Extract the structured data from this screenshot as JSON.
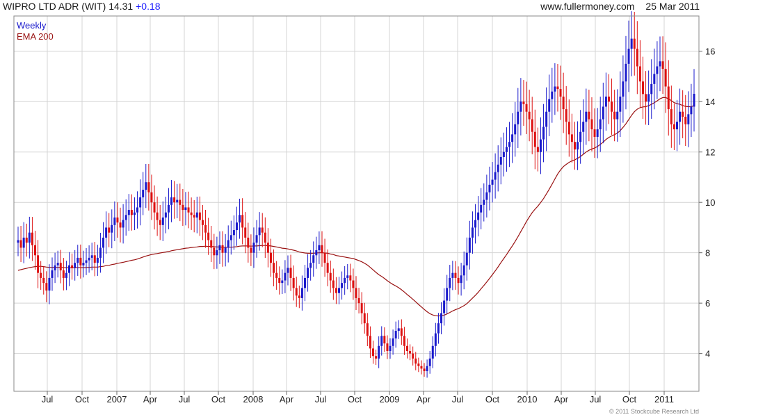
{
  "header": {
    "title": "WIPRO LTD ADR (WIT)",
    "last": "14.31",
    "change": "+0.18",
    "site": "www.fullermoney.com",
    "date": "25 Mar 2011"
  },
  "credit": "© 2011 Stockcube Research Ltd",
  "colors": {
    "up": "#1a1acc",
    "down": "#dd1111",
    "ema": "#991111",
    "grid": "#d4d4d4",
    "frame": "#888888"
  },
  "chart_data": {
    "type": "candlestick",
    "grid": true,
    "ylim": [
      2.5,
      17.4
    ],
    "y_ticks": [
      4,
      6,
      8,
      10,
      12,
      14,
      16
    ],
    "x_ticks": [
      "Jul",
      "Oct",
      "2007",
      "Apr",
      "Jul",
      "Oct",
      "2008",
      "Apr",
      "Jul",
      "Oct",
      "2009",
      "Apr",
      "Jul",
      "Oct",
      "2010",
      "Apr",
      "Jul",
      "Oct",
      "2011"
    ],
    "legend": [
      {
        "label": "Weekly",
        "color": "#1a1acc"
      },
      {
        "label": "EMA 200",
        "color": "#991111"
      }
    ],
    "series": [
      {
        "name": "Weekly",
        "close": [
          8.5,
          8.2,
          8.6,
          8.4,
          8.8,
          8.3,
          7.9,
          7.2,
          7.0,
          6.8,
          6.5,
          7.0,
          7.3,
          7.5,
          7.6,
          7.3,
          7.0,
          7.2,
          7.5,
          7.4,
          7.6,
          7.8,
          7.5,
          7.6,
          7.7,
          7.8,
          7.9,
          7.6,
          7.8,
          8.2,
          8.6,
          9.0,
          8.8,
          9.1,
          9.4,
          9.2,
          9.0,
          9.3,
          9.5,
          9.7,
          9.5,
          9.6,
          9.8,
          10.2,
          10.5,
          10.8,
          10.4,
          10.0,
          9.6,
          9.3,
          9.1,
          9.4,
          9.6,
          9.9,
          10.2,
          10.0,
          10.1,
          9.9,
          9.7,
          9.8,
          9.6,
          9.5,
          9.4,
          9.6,
          9.3,
          9.1,
          8.8,
          8.5,
          8.2,
          7.9,
          8.1,
          8.3,
          8.0,
          8.2,
          8.5,
          8.7,
          8.9,
          9.2,
          9.5,
          9.0,
          8.6,
          8.2,
          8.0,
          8.4,
          8.7,
          9.0,
          8.8,
          8.4,
          8.0,
          7.6,
          7.2,
          7.0,
          6.8,
          6.9,
          7.2,
          7.4,
          7.0,
          6.6,
          6.3,
          6.2,
          6.6,
          7.0,
          7.4,
          7.6,
          7.9,
          8.1,
          8.3,
          8.0,
          7.6,
          7.2,
          6.9,
          6.6,
          6.4,
          6.6,
          6.8,
          7.0,
          7.1,
          6.9,
          6.6,
          6.2,
          6.0,
          5.6,
          5.2,
          4.7,
          4.2,
          3.9,
          3.8,
          4.3,
          4.7,
          4.4,
          4.1,
          4.3,
          4.6,
          4.9,
          5.0,
          4.7,
          4.3,
          4.1,
          4.0,
          3.8,
          3.6,
          3.5,
          3.4,
          3.3,
          3.5,
          3.8,
          4.3,
          4.8,
          5.2,
          5.6,
          6.1,
          6.6,
          7.0,
          7.2,
          7.0,
          6.8,
          7.1,
          7.5,
          8.0,
          8.6,
          9.0,
          9.3,
          9.6,
          9.9,
          10.1,
          10.4,
          10.7,
          10.9,
          11.2,
          11.5,
          11.8,
          12.0,
          12.2,
          12.4,
          12.7,
          13.1,
          13.6,
          14.0,
          13.9,
          13.6,
          13.3,
          12.8,
          12.2,
          12.0,
          12.5,
          13.0,
          13.6,
          14.1,
          14.4,
          14.6,
          14.5,
          14.2,
          13.7,
          13.2,
          12.7,
          12.4,
          12.1,
          12.4,
          12.8,
          13.2,
          13.6,
          13.3,
          12.9,
          12.6,
          12.9,
          13.3,
          13.8,
          14.2,
          14.0,
          13.6,
          13.3,
          13.6,
          14.2,
          14.8,
          15.5,
          16.1,
          16.5,
          16.1,
          15.4,
          14.8,
          14.3,
          14.0,
          14.3,
          14.7,
          15.1,
          15.4,
          15.6,
          15.3,
          14.6,
          13.7,
          13.1,
          12.9,
          13.2,
          13.6,
          13.4,
          13.1,
          13.5,
          13.8,
          14.31
        ]
      },
      {
        "name": "EMA 200",
        "values": [
          7.3,
          7.33,
          7.36,
          7.38,
          7.41,
          7.43,
          7.45,
          7.46,
          7.46,
          7.45,
          7.43,
          7.42,
          7.42,
          7.42,
          7.42,
          7.42,
          7.41,
          7.4,
          7.4,
          7.4,
          7.4,
          7.41,
          7.41,
          7.41,
          7.41,
          7.42,
          7.43,
          7.43,
          7.43,
          7.45,
          7.46,
          7.49,
          7.5,
          7.53,
          7.55,
          7.58,
          7.6,
          7.62,
          7.65,
          7.67,
          7.7,
          7.72,
          7.75,
          7.79,
          7.83,
          7.87,
          7.9,
          7.93,
          7.95,
          7.97,
          7.99,
          8.01,
          8.03,
          8.05,
          8.08,
          8.1,
          8.12,
          8.14,
          8.16,
          8.18,
          8.19,
          8.21,
          8.22,
          8.23,
          8.25,
          8.25,
          8.26,
          8.25,
          8.25,
          8.24,
          8.23,
          8.23,
          8.22,
          8.22,
          8.22,
          8.22,
          8.23,
          8.24,
          8.26,
          8.27,
          8.27,
          8.27,
          8.26,
          8.27,
          8.27,
          8.28,
          8.29,
          8.29,
          8.28,
          8.27,
          8.25,
          8.23,
          8.21,
          8.18,
          8.17,
          8.15,
          8.13,
          8.1,
          8.07,
          8.03,
          8.01,
          7.99,
          7.98,
          7.98,
          7.98,
          7.99,
          8.0,
          8.0,
          7.99,
          7.98,
          7.95,
          7.93,
          7.89,
          7.87,
          7.85,
          7.83,
          7.81,
          7.79,
          7.77,
          7.73,
          7.69,
          7.64,
          7.58,
          7.51,
          7.42,
          7.32,
          7.22,
          7.13,
          7.06,
          6.98,
          6.89,
          6.81,
          6.74,
          6.68,
          6.61,
          6.53,
          6.44,
          6.34,
          6.25,
          6.15,
          6.05,
          5.95,
          5.85,
          5.75,
          5.66,
          5.58,
          5.53,
          5.5,
          5.49,
          5.5,
          5.52,
          5.57,
          5.63,
          5.69,
          5.74,
          5.78,
          5.84,
          5.9,
          5.98,
          6.09,
          6.2,
          6.31,
          6.43,
          6.57,
          6.7,
          6.84,
          6.98,
          7.13,
          7.28,
          7.44,
          7.61,
          7.77,
          7.93,
          8.1,
          8.27,
          8.45,
          8.64,
          8.84,
          9.04,
          9.24,
          9.42,
          9.59,
          9.73,
          9.85,
          10.0,
          10.15,
          10.33,
          10.52,
          10.72,
          10.93,
          11.13,
          11.29,
          11.42,
          11.51,
          11.59,
          11.65,
          11.69,
          11.75,
          11.82,
          11.91,
          12.0,
          12.07,
          12.12,
          12.16,
          12.22,
          12.3,
          12.39,
          12.5,
          12.58,
          12.64,
          12.69,
          12.75,
          12.85,
          12.98,
          13.12,
          13.29,
          13.46,
          13.6,
          13.7,
          13.76,
          13.79,
          13.8,
          13.84,
          13.89,
          13.96,
          14.03,
          14.11,
          14.16,
          14.16,
          14.11,
          14.04,
          13.96,
          13.92,
          13.89,
          13.85,
          13.81,
          13.8,
          13.8,
          13.85
        ]
      }
    ]
  }
}
